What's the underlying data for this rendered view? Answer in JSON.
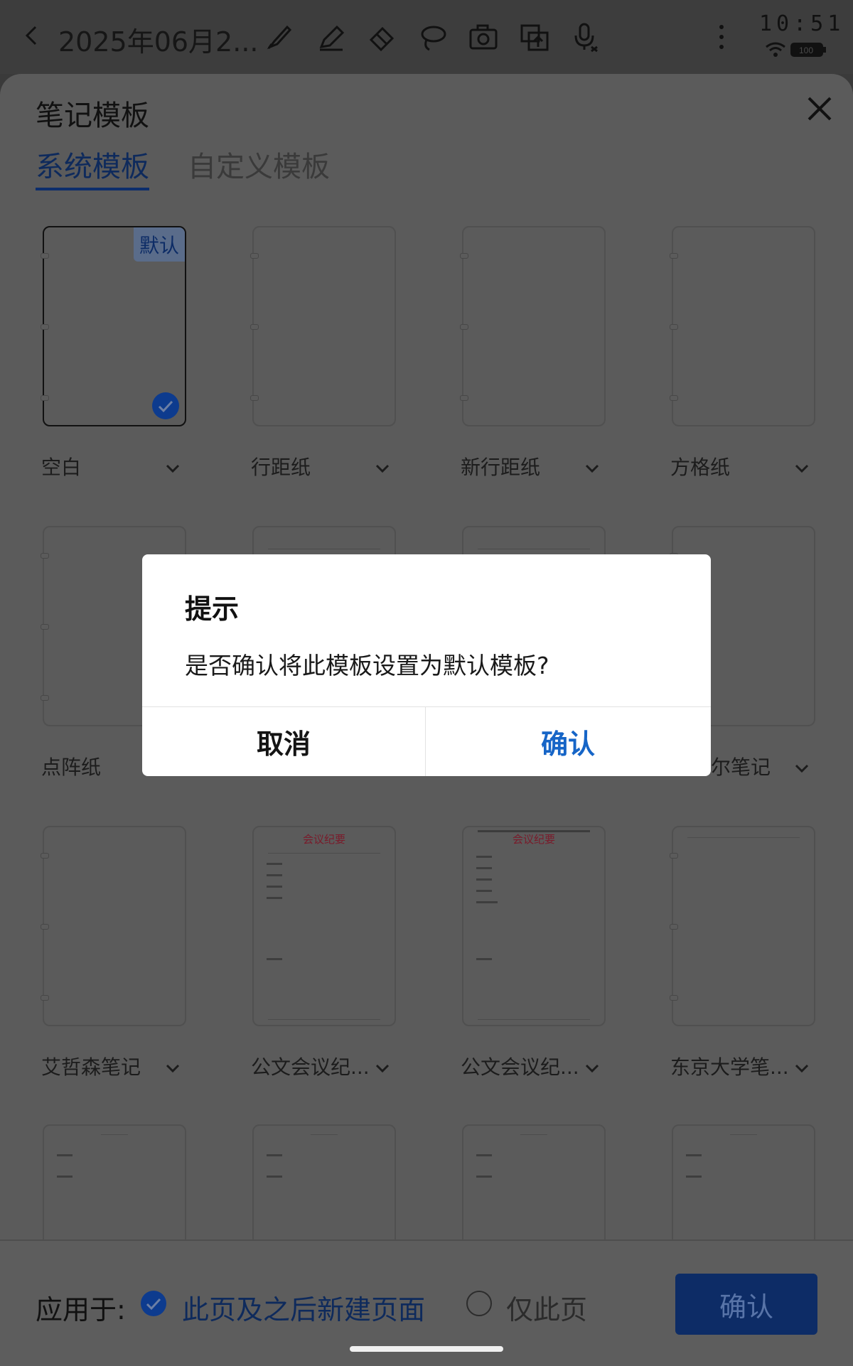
{
  "header": {
    "doc_title": "2025年06月2...",
    "time": "10:51",
    "tools": [
      "brush-icon",
      "pen-icon",
      "eraser-icon",
      "lasso-icon",
      "camera-icon",
      "insert-image-icon",
      "mic-icon"
    ],
    "battery": "100"
  },
  "sheet": {
    "title": "笔记模板",
    "tabs": [
      {
        "label": "系统模板",
        "active": true
      },
      {
        "label": "自定义模板",
        "active": false
      }
    ],
    "default_badge": "默认",
    "templates": [
      {
        "label": "空白",
        "selected": true
      },
      {
        "label": "行距纸"
      },
      {
        "label": "新行距纸"
      },
      {
        "label": "方格纸"
      },
      {
        "label": "点阵纸"
      },
      {
        "label": ""
      },
      {
        "label": ""
      },
      {
        "label": "尔笔记"
      },
      {
        "label": "艾哲森笔记"
      },
      {
        "label": "公文会议纪..."
      },
      {
        "label": "公文会议纪..."
      },
      {
        "label": "东京大学笔..."
      }
    ],
    "thumb_heading_1": "会议纪要",
    "thumb_heading_2": "会议纪要"
  },
  "bottom": {
    "apply_label": "应用于:",
    "option_1": "此页及之后新建页面",
    "option_2": "仅此页",
    "confirm": "确认"
  },
  "dialog": {
    "title": "提示",
    "message": "是否确认将此模板设置为默认模板?",
    "cancel": "取消",
    "ok": "确认"
  },
  "colors": {
    "accent": "#0d3b8e",
    "dialog_ok": "#1665c7",
    "overlay": "#5b5b5b"
  }
}
